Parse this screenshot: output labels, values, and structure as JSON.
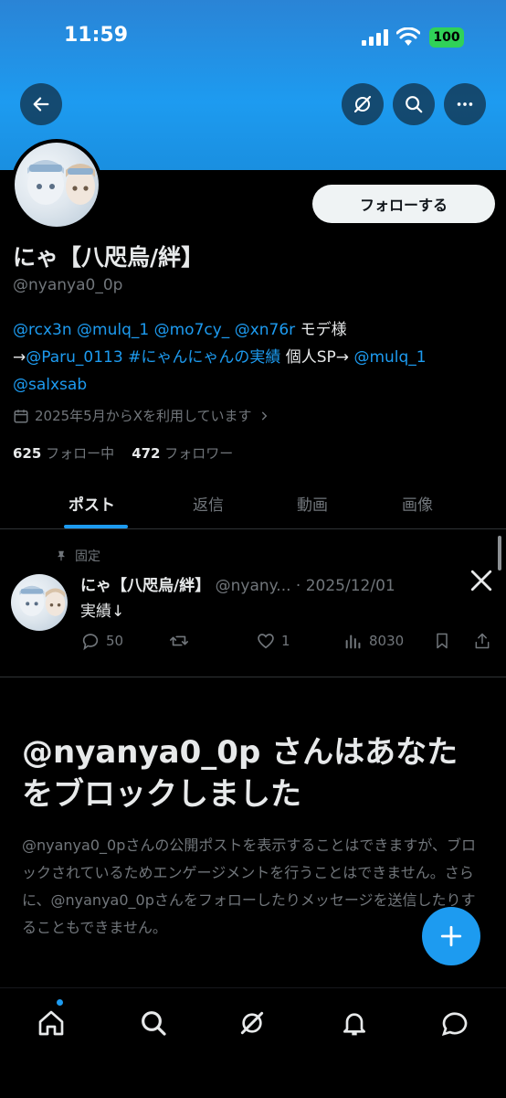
{
  "status_bar": {
    "time": "11:59",
    "battery": "100"
  },
  "header": {
    "icons": [
      "back-arrow-icon",
      "grok-icon",
      "search-icon",
      "more-icon"
    ]
  },
  "profile": {
    "follow_button": "フォローする",
    "display_name": "にゃ【八咫烏/絆】",
    "handle": "@nyanya0_0p",
    "bio": {
      "line1_links": [
        "@rcx3n",
        "@mulq_1",
        "@mo7cy_",
        "@xn76r"
      ],
      "line1_text": "モデ様",
      "line2_arrow": "→",
      "line2_link1": "@Paru_0113",
      "line2_link2": "#にゃんにゃんの実績",
      "line2_text": "個人SP→",
      "line2_link3": "@mulq_1",
      "line3_link": "@salxsab"
    },
    "joined": "2025年5月からXを利用しています",
    "following_count": "625",
    "following_label": "フォロー中",
    "followers_count": "472",
    "followers_label": "フォロワー"
  },
  "tabs": [
    "ポスト",
    "返信",
    "動画",
    "画像"
  ],
  "pinned_post": {
    "pinned_label": "固定",
    "author": "にゃ【八咫烏/絆】",
    "handle_trunc": "@nyany...",
    "date": "2025/12/01",
    "text": "実績↓",
    "replies": "50",
    "likes": "1",
    "views": "8030"
  },
  "blocked": {
    "title": "@nyanya0_0p さんはあなたをブロックしました",
    "description": "@nyanya0_0pさんの公開ポストを表示することはできますが、ブロックされているためエンゲージメントを行うことはできません。さらに、@nyanya0_0pさんをフォローしたりメッセージを送信したりすることもできません。"
  },
  "bottom_nav": [
    "home-icon",
    "search-icon",
    "grok-icon",
    "notifications-icon",
    "messages-icon"
  ],
  "colors": {
    "accent": "#1d9bf0",
    "background": "#000000",
    "text": "#e7e9ea",
    "muted": "#71767b"
  }
}
